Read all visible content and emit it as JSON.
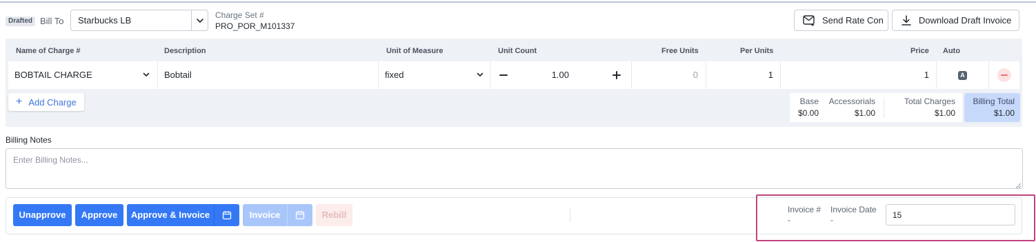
{
  "header": {
    "status_badge": "Drafted",
    "bill_to_label": "Bill To",
    "bill_to_value": "Starbucks LB",
    "charge_set_label": "Charge Set #",
    "charge_set_value": "PRO_POR_M101337",
    "send_rate_con_label": "Send Rate Con",
    "download_draft_invoice_label": "Download Draft Invoice"
  },
  "table": {
    "columns": [
      "Name of Charge #",
      "Description",
      "Unit of Measure",
      "Unit Count",
      "Free Units",
      "Per Units",
      "Price",
      "Auto"
    ],
    "rows": [
      {
        "name": "BOBTAIL CHARGE",
        "description": "Bobtail",
        "unit_of_measure": "fixed",
        "unit_count": "1.00",
        "free_units": "0",
        "per_units": "1",
        "price": "1",
        "auto": "A"
      }
    ],
    "add_charge_label": "Add Charge"
  },
  "totals": {
    "base_label": "Base",
    "base_value": "$0.00",
    "accessorials_label": "Accessorials",
    "accessorials_value": "$1.00",
    "total_charges_label": "Total Charges",
    "total_charges_value": "$1.00",
    "billing_total_label": "Billing Total",
    "billing_total_value": "$1.00"
  },
  "notes": {
    "label": "Billing Notes",
    "placeholder": "Enter Billing Notes..."
  },
  "actions": {
    "unapprove_label": "Unapprove",
    "approve_label": "Approve",
    "approve_invoice_label": "Approve & Invoice",
    "invoice_label": "Invoice",
    "rebill_label": "Rebill"
  },
  "invoice": {
    "number_label": "Invoice #",
    "number_value": "-",
    "date_label": "Invoice Date",
    "date_value": "-",
    "date_input_value": "15"
  },
  "colors": {
    "primary": "#3478f6",
    "primary_disabled": "#a9c6fb",
    "billing_total_bg": "#c6d9fb",
    "highlight_border": "#c0427d",
    "remove_icon": "#ef6e6e"
  }
}
